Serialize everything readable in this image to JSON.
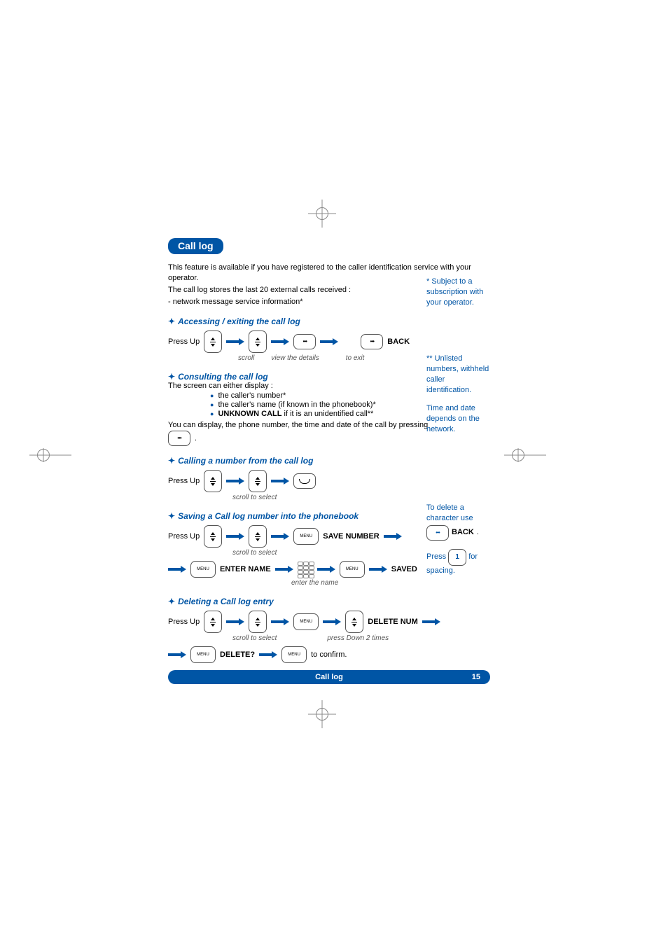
{
  "title": "Call log",
  "intro": {
    "line1": "This feature is available if you have registered to the caller identification service with your operator.",
    "line2": "The call log stores the last 20 external calls received :",
    "line3": "- network message service information*"
  },
  "sections": {
    "accessing": {
      "heading": "Accessing / exiting the call log",
      "press_up": "Press Up",
      "back": "BACK",
      "cap_scroll": "scroll",
      "cap_view": "view the details",
      "cap_exit": "to exit"
    },
    "consulting": {
      "heading": "Consulting the call log",
      "line1": "The screen can either display :",
      "bullet1": "the caller's number*",
      "bullet2": "the caller's name (if known in the phonebook)*",
      "bullet3_prefix": "",
      "bullet3_bold": "UNKNOWN CALL",
      "bullet3_suffix": " if it is an unidentified call**",
      "line2": "You can display, the phone number, the time and date of the call by pressing",
      "period": "."
    },
    "calling": {
      "heading": "Calling a number from the call log",
      "press_up": "Press Up",
      "cap": "scroll to select"
    },
    "saving": {
      "heading": "Saving a Call log number into the phonebook",
      "press_up": "Press Up",
      "cap1": "scroll to select",
      "save_number": "SAVE NUMBER",
      "enter_name": "ENTER NAME",
      "cap2": "enter the name",
      "saved": "SAVED"
    },
    "deleting": {
      "heading": "Deleting a Call log entry",
      "press_up": "Press Up",
      "cap1": "scroll to select",
      "delete_num": "DELETE NUM",
      "cap2": "press Down 2 times",
      "delete_q": "DELETE?",
      "confirm": "to confirm."
    }
  },
  "sidebar": {
    "note1": "* Subject to a subscription with your operator.",
    "note2": "** Unlisted numbers, withheld caller identification.",
    "note3": "Time and date depends on the network.",
    "note4_a": "To delete a character use",
    "note4_back": "BACK",
    "note4_dot": ".",
    "note5_a": "Press",
    "note5_key": "1",
    "note5_b": "for spacing."
  },
  "footer": {
    "label": "Call log",
    "page": "15"
  },
  "icons": {
    "menu": "MENU"
  }
}
